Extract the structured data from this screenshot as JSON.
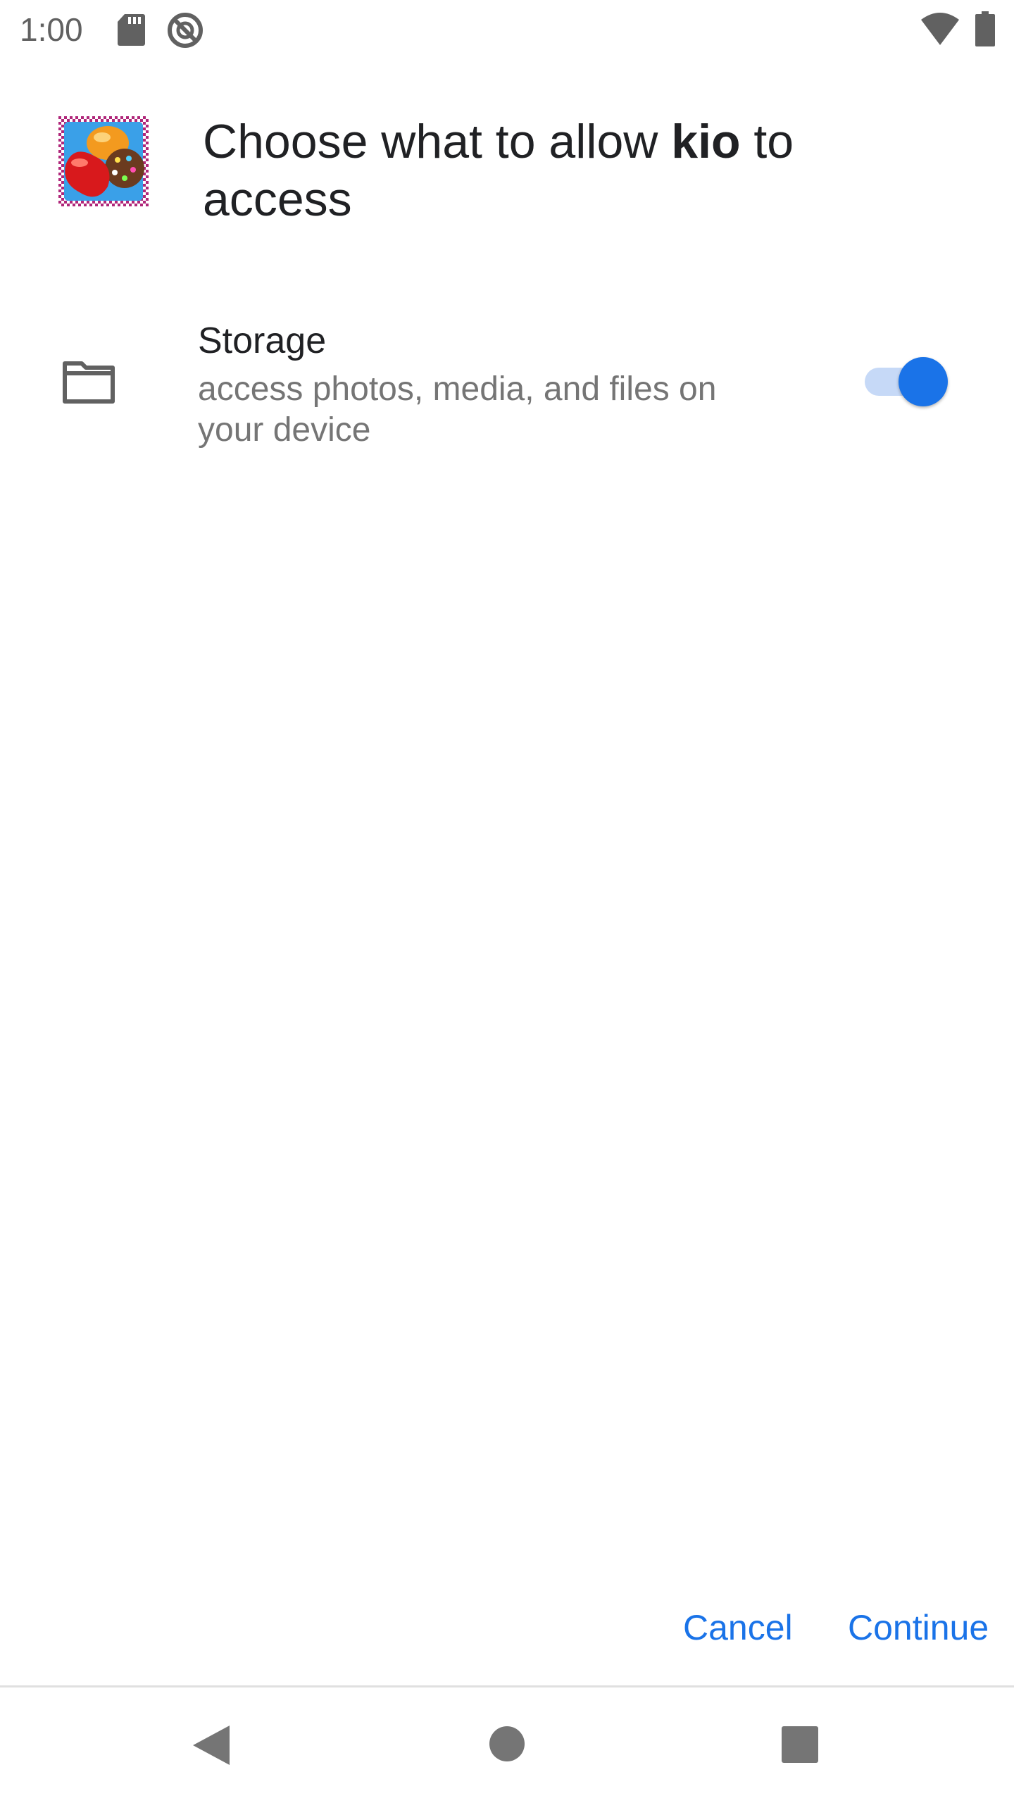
{
  "status_bar": {
    "time": "1:00",
    "icons": [
      "sd-card-icon",
      "sync-icon",
      "wifi-icon",
      "battery-icon"
    ]
  },
  "dialog": {
    "title_prefix": "Choose what to allow ",
    "app_name": "kio",
    "title_suffix": " to access",
    "app_icon": "candy-crush-app-icon"
  },
  "permissions": [
    {
      "icon": "folder-icon",
      "title": "Storage",
      "description": "access photos, media, and files on your device",
      "enabled": true
    }
  ],
  "actions": {
    "cancel_label": "Cancel",
    "continue_label": "Continue"
  },
  "nav_bar": {
    "icons": [
      "back-icon",
      "home-icon",
      "recents-icon"
    ]
  },
  "colors": {
    "accent": "#1a73e8",
    "toggle_track": "#c6d9f7",
    "primary_text": "#202124",
    "secondary_text": "#757575",
    "status_icons": "#616161"
  }
}
